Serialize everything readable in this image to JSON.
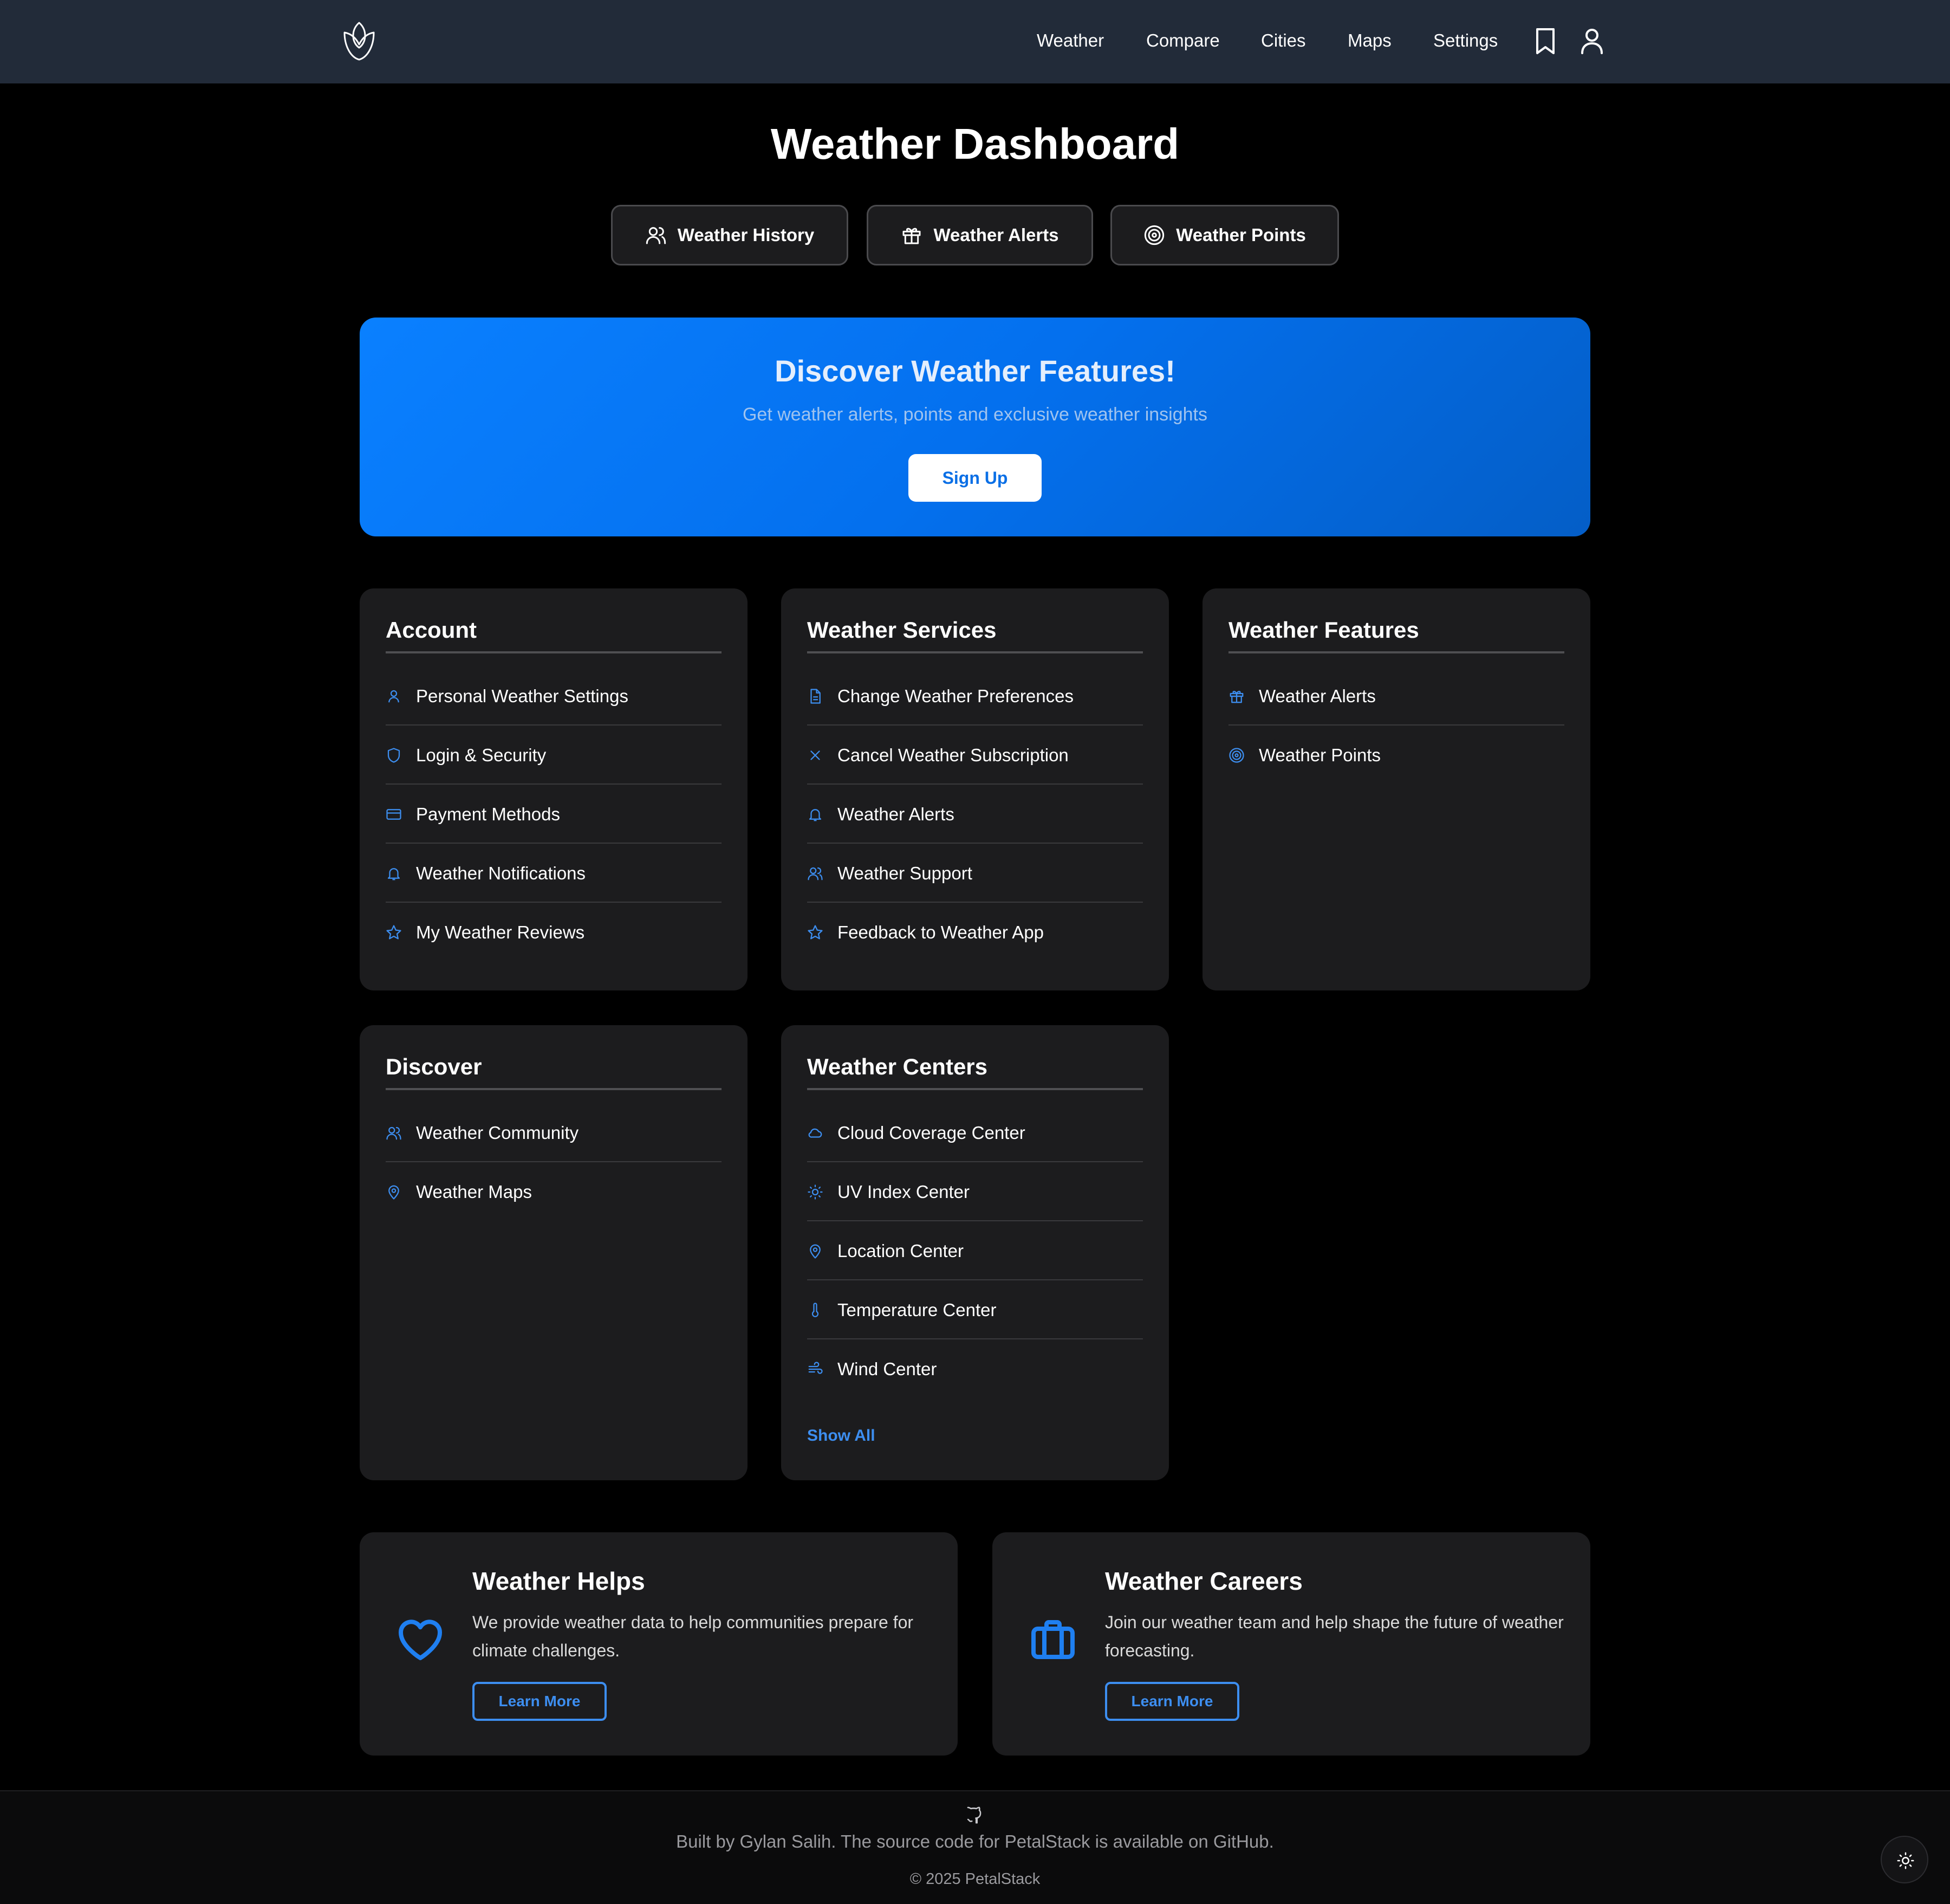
{
  "colors": {
    "navbar_bg": "#222b39",
    "accent": "#3d8ef0",
    "card_bg": "#1c1c1e",
    "hero_gradient_start": "#0a80ff",
    "hero_gradient_end": "#045ec7"
  },
  "nav": {
    "logo_icon": "tulip-logo-icon",
    "links": [
      "Weather",
      "Compare",
      "Cities",
      "Maps",
      "Settings"
    ],
    "bookmark_icon": "bookmark-icon",
    "user_icon": "user-icon"
  },
  "page_title": "Weather Dashboard",
  "quick_buttons": [
    {
      "label": "Weather History",
      "icon": "users-icon"
    },
    {
      "label": "Weather Alerts",
      "icon": "gift-icon"
    },
    {
      "label": "Weather Points",
      "icon": "target-icon"
    }
  ],
  "hero": {
    "title": "Discover Weather Features!",
    "subtitle": "Get weather alerts, points and exclusive weather insights",
    "button": "Sign Up"
  },
  "cards": {
    "account": {
      "title": "Account",
      "items": [
        {
          "label": "Personal Weather Settings",
          "icon": "user-icon"
        },
        {
          "label": "Login & Security",
          "icon": "shield-icon"
        },
        {
          "label": "Payment Methods",
          "icon": "credit-card-icon"
        },
        {
          "label": "Weather Notifications",
          "icon": "bell-icon"
        },
        {
          "label": "My Weather Reviews",
          "icon": "star-icon"
        }
      ]
    },
    "services": {
      "title": "Weather Services",
      "items": [
        {
          "label": "Change Weather Preferences",
          "icon": "document-icon"
        },
        {
          "label": "Cancel Weather Subscription",
          "icon": "x-icon"
        },
        {
          "label": "Weather Alerts",
          "icon": "bell-icon"
        },
        {
          "label": "Weather Support",
          "icon": "users-icon"
        },
        {
          "label": "Feedback to Weather App",
          "icon": "star-icon"
        }
      ]
    },
    "features": {
      "title": "Weather Features",
      "items": [
        {
          "label": "Weather Alerts",
          "icon": "gift-icon"
        },
        {
          "label": "Weather Points",
          "icon": "target-icon"
        }
      ]
    },
    "discover": {
      "title": "Discover",
      "items": [
        {
          "label": "Weather Community",
          "icon": "users-icon"
        },
        {
          "label": "Weather Maps",
          "icon": "map-pin-icon"
        }
      ]
    },
    "centers": {
      "title": "Weather Centers",
      "items": [
        {
          "label": "Cloud Coverage Center",
          "icon": "cloud-icon"
        },
        {
          "label": "UV Index Center",
          "icon": "sun-icon"
        },
        {
          "label": "Location Center",
          "icon": "map-pin-icon"
        },
        {
          "label": "Temperature Center",
          "icon": "thermometer-icon"
        },
        {
          "label": "Wind Center",
          "icon": "wind-icon"
        }
      ],
      "show_all": "Show All"
    }
  },
  "info": {
    "helps": {
      "title": "Weather Helps",
      "text": "We provide weather data to help communities prepare for climate challenges.",
      "button": "Learn More",
      "icon": "heart-icon"
    },
    "careers": {
      "title": "Weather Careers",
      "text": "Join our weather team and help shape the future of weather forecasting.",
      "button": "Learn More",
      "icon": "briefcase-icon"
    }
  },
  "footer": {
    "icon": "github-icon",
    "text": "Built by Gylan Salih. The source code for PetalStack is available on GitHub.",
    "copyright": "© 2025 PetalStack",
    "theme_icon": "sun-icon"
  }
}
